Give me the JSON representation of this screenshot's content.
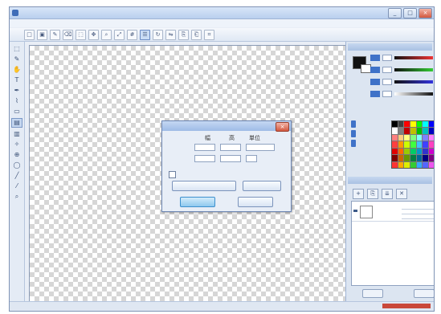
{
  "window": {
    "title": "",
    "min_label": "_",
    "max_label": "□",
    "close_label": "×"
  },
  "menu": [],
  "toolbar_icons": [
    "new-icon",
    "save-icon",
    "pen-icon",
    "eraser-icon",
    "select-icon",
    "move-icon",
    "zoom-icon",
    "fit-icon",
    "grid-icon",
    "layer-icon",
    "rotate-icon",
    "flip-icon",
    "copy-icon",
    "paste-icon",
    "crop-icon"
  ],
  "left_tools": [
    "select",
    "lasso",
    "hand",
    "text",
    "pen",
    "brush",
    "eraser",
    "fill",
    "gradient",
    "spray",
    "stamp",
    "shape",
    "line",
    "picker",
    "zoom"
  ],
  "left_tool_glyphs": [
    "⬚",
    "✎",
    "✋",
    "T",
    "✒",
    "⌇",
    "▭",
    "▤",
    "▥",
    "✧",
    "⊕",
    "◯",
    "╱",
    "⁄",
    "⌕"
  ],
  "status": {
    "left": "",
    "right": ""
  },
  "palette_colors": [
    "#000000",
    "#404040",
    "#ff0000",
    "#ffff00",
    "#00ff00",
    "#00ffff",
    "#0000ff",
    "#ff00ff",
    "#ffffff",
    "#808080",
    "#c00000",
    "#c0c000",
    "#00c000",
    "#00c0c0",
    "#0000c0",
    "#c000c0",
    "#ff8080",
    "#ffcc80",
    "#ffff80",
    "#80ff80",
    "#80ffff",
    "#8080ff",
    "#ff80ff",
    "#c08040",
    "#ff4040",
    "#ff9900",
    "#ccff00",
    "#40ff40",
    "#40c0ff",
    "#4040ff",
    "#ff40c0",
    "#804000",
    "#e00000",
    "#ff6600",
    "#99cc00",
    "#00cc66",
    "#0099cc",
    "#3333cc",
    "#cc00cc",
    "#663300",
    "#800000",
    "#cc6600",
    "#669900",
    "#008040",
    "#006699",
    "#000080",
    "#800080",
    "#333300",
    "#ff3333",
    "#ffaa00",
    "#ddee00",
    "#33cc33",
    "#33aaff",
    "#5566ff",
    "#ee55ee",
    "#996633"
  ],
  "dialog": {
    "title": "",
    "close_label": "×",
    "col_width": "幅",
    "col_height": "高",
    "col_unit": "単位",
    "row1_label": "",
    "row1_width": "",
    "row1_height": "",
    "row1_unit": "",
    "row2_label": "",
    "row2_width": "",
    "row2_height": "",
    "row2_unit": "",
    "checkbox_label": "",
    "btn1_label": "",
    "btn2_label": "",
    "ok_label": "",
    "cancel_label": ""
  }
}
